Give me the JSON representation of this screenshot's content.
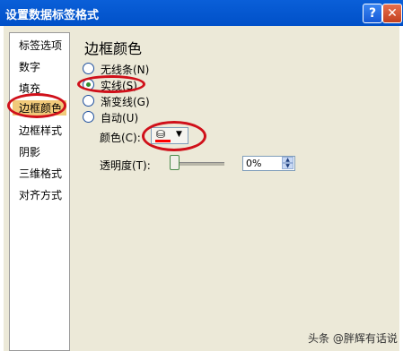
{
  "window": {
    "title": "设置数据标签格式",
    "help_label": "?",
    "close_label": "✕"
  },
  "sidebar": {
    "items": [
      {
        "label": "标签选项"
      },
      {
        "label": "数字"
      },
      {
        "label": "填充"
      },
      {
        "label": "边框颜色",
        "selected": true
      },
      {
        "label": "边框样式"
      },
      {
        "label": "阴影"
      },
      {
        "label": "三维格式"
      },
      {
        "label": "对齐方式"
      }
    ]
  },
  "panel": {
    "heading": "边框颜色",
    "options": [
      {
        "label": "无线条(N)",
        "checked": false
      },
      {
        "label": "实线(S)",
        "checked": true
      },
      {
        "label": "渐变线(G)",
        "checked": false
      },
      {
        "label": "自动(U)",
        "checked": false
      }
    ],
    "color_label": "颜色(C):",
    "color_value": "#ff0000",
    "transparency_label": "透明度(T):",
    "transparency_value": "0%",
    "transparency_level": 0
  },
  "watermark": "头条 @胖辉有话说",
  "icons": {
    "fill_bucket": "paint-bucket-icon",
    "dropdown": "chevron-down-icon"
  },
  "colors": {
    "titlebar": "#0055d4",
    "annotation": "#d0101a",
    "selected_item": "#f1ca7a"
  }
}
